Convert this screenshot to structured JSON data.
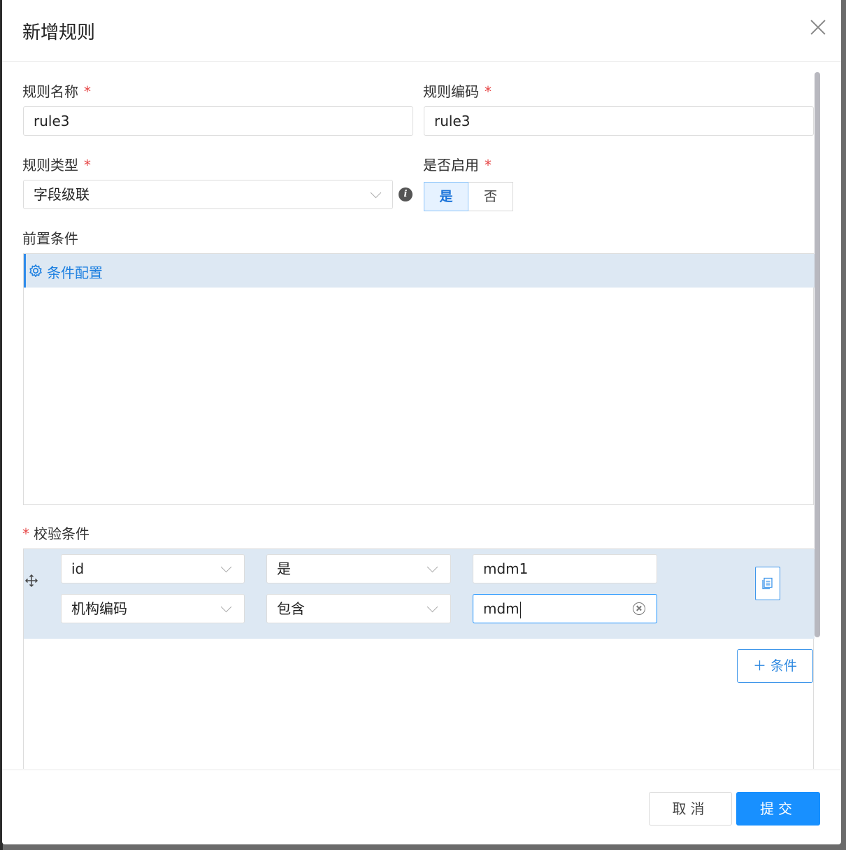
{
  "modal": {
    "title": "新增规则"
  },
  "form": {
    "rule_name": {
      "label": "规则名称",
      "required": "*",
      "value": "rule3"
    },
    "rule_code": {
      "label": "规则编码",
      "required": "*",
      "value": "rule3"
    },
    "rule_type": {
      "label": "规则类型",
      "required": "*",
      "value": "字段级联",
      "info": "i"
    },
    "enabled": {
      "label": "是否启用",
      "required": "*",
      "options": [
        "是",
        "否"
      ],
      "selected": "是"
    },
    "precondition": {
      "label": "前置条件",
      "panel_title": "条件配置"
    },
    "check": {
      "label": "校验条件",
      "required": "*",
      "conditions": [
        {
          "field": "id",
          "operator": "是",
          "value": "mdm1"
        },
        {
          "field": "机构编码",
          "operator": "包含",
          "value": "mdm"
        }
      ],
      "add_label": "＋ 条件"
    }
  },
  "footer": {
    "cancel_label": "取消",
    "submit_label": "提交"
  },
  "colors": {
    "primary": "#1890ff",
    "required": "#e64545",
    "panel_bg": "#dde8f3"
  },
  "icons": [
    "close-icon",
    "chevron-down-icon",
    "info-icon",
    "gear-icon",
    "move-icon",
    "copy-icon",
    "clear-icon",
    "plus-icon"
  ]
}
